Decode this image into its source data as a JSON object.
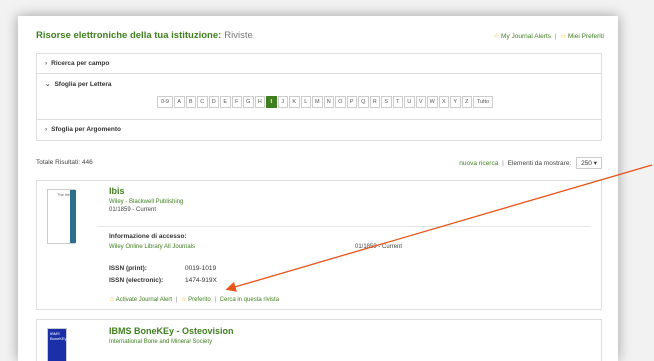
{
  "header": {
    "title": "Risorse elettroniche della tua istituzione:",
    "subtitle": "Riviste",
    "alerts_link": "My Journal Alerts",
    "favorites_link": "Miei Preferiti",
    "sep": "|"
  },
  "filters": {
    "search_by_field": "Ricerca per campo",
    "browse_by_letter": "Sfoglia per Lettera",
    "browse_by_topic": "Sfoglia per Argomento",
    "letters": [
      "0-9",
      "A",
      "B",
      "C",
      "D",
      "E",
      "F",
      "G",
      "H",
      "I",
      "J",
      "K",
      "L",
      "M",
      "N",
      "O",
      "P",
      "Q",
      "R",
      "S",
      "T",
      "U",
      "V",
      "W",
      "X",
      "Y",
      "Z",
      "Tutto"
    ],
    "active_letter": "I"
  },
  "results": {
    "total": "Totale Risultati: 446",
    "new_search": "nuova ricerca",
    "sep": "|",
    "per_page_label": "Elementi da mostrare:",
    "per_page_value": "250"
  },
  "journals": [
    {
      "thumb_text": "The Ibis",
      "title": "Ibis",
      "publisher": "Wiley - Blackwell Publishing",
      "coverage": "01/1859 - Current",
      "access_label": "Informazione di accesso:",
      "access_source": "Wiley Online Library All Journals",
      "access_dates": "01/1859 - Current",
      "issn_print_label": "ISSN (print):",
      "issn_print": "0019-1019",
      "issn_electronic_label": "ISSN (electronic):",
      "issn_electronic": "1474-919X",
      "action_alert": "Activate Journal Alert",
      "action_favorite": "Preferito",
      "action_search": "Cerca in questa rivista",
      "sep": "|"
    },
    {
      "thumb_text": "IBMS BoneKEy",
      "title": "IBMS BoneKEy - Osteovision",
      "publisher": "International Bone and Mineral Society"
    }
  ],
  "colors": {
    "accent": "#3f7f1f",
    "arrow": "#e8541a",
    "star": "#e8b000"
  }
}
